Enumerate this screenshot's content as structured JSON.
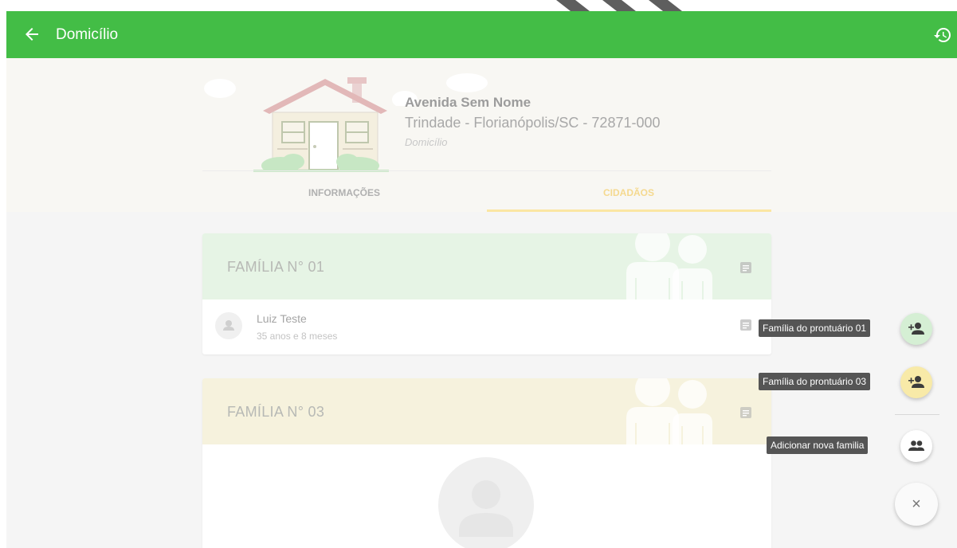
{
  "app_bar": {
    "title": "Domicílio",
    "back_icon": "arrow-left-icon",
    "history_icon": "history-icon",
    "color": "#43bd46"
  },
  "address": {
    "street": "Avenida Sem Nome",
    "city_line": "Trindade - Florianópolis/SC - 72871-000",
    "type": "Domicílio"
  },
  "tabs": [
    {
      "label": "INFORMAÇÕES",
      "active": false
    },
    {
      "label": "CIDADÃOS",
      "active": true
    }
  ],
  "families": [
    {
      "title": "FAMÍLIA N° 01",
      "color": "#e6f4e5",
      "members": [
        {
          "name": "Luiz Teste",
          "age": "35 anos e 8 meses"
        }
      ]
    },
    {
      "title": "FAMÍLIA N° 03",
      "color": "#f6f2dd",
      "members": []
    }
  ],
  "fab_menu": {
    "items": [
      {
        "label": "Família do prontuário 01",
        "icon": "person-add-icon",
        "color": "#d5efd4"
      },
      {
        "label": "Família do prontuário 03",
        "icon": "person-add-icon",
        "color": "#f8eaa8"
      },
      {
        "label": "Adicionar nova familia",
        "icon": "group-icon",
        "color": "#ffffff"
      }
    ],
    "close_label": "×"
  }
}
